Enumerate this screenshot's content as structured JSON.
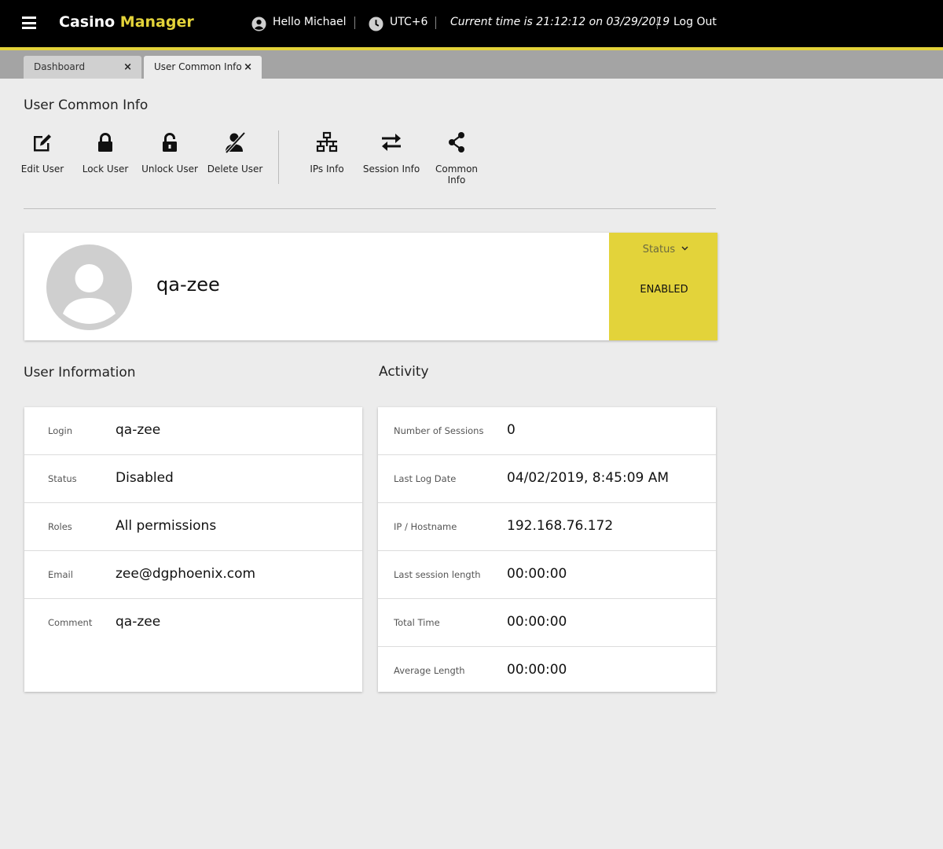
{
  "app": {
    "brand_main": "Casino",
    "brand_accent": "Manager"
  },
  "header": {
    "greeting": "Hello Michael",
    "timezone": "UTC+6",
    "current_time": "Current time is 21:12:12 on 03/29/2019",
    "logout": "Log Out"
  },
  "tabs": [
    {
      "label": "Dashboard",
      "close": "×"
    },
    {
      "label": "User Common Info",
      "close": "×"
    }
  ],
  "page": {
    "title": "User Common Info"
  },
  "toolbar": {
    "edit_user": "Edit User",
    "lock_user": "Lock User",
    "unlock_user": "Unlock User",
    "delete_user": "Delete User",
    "ips_info": "IPs Info",
    "session_info": "Session Info",
    "common_info": "Common Info"
  },
  "profile": {
    "username": "qa-zee",
    "status_label": "Status",
    "status_value": "ENABLED"
  },
  "user_information": {
    "title": "User Information",
    "rows": [
      {
        "key": "Login",
        "value": "qa-zee"
      },
      {
        "key": "Status",
        "value": "Disabled"
      },
      {
        "key": "Roles",
        "value": "All permissions"
      },
      {
        "key": "Email",
        "value": "zee@dgphoenix.com"
      },
      {
        "key": "Comment",
        "value": "qa-zee"
      }
    ]
  },
  "activity": {
    "title": "Activity",
    "rows": [
      {
        "key": "Number of Sessions",
        "value": "0"
      },
      {
        "key": "Last Log Date",
        "value": "04/02/2019, 8:45:09 AM"
      },
      {
        "key": "IP / Hostname",
        "value": "192.168.76.172"
      },
      {
        "key": "Last session length",
        "value": "00:00:00"
      },
      {
        "key": "Total Time",
        "value": "00:00:00"
      },
      {
        "key": "Average Length",
        "value": "00:00:00"
      }
    ]
  },
  "colors": {
    "accent": "#e3d33a",
    "topbar": "#000000",
    "background": "#ececec"
  }
}
